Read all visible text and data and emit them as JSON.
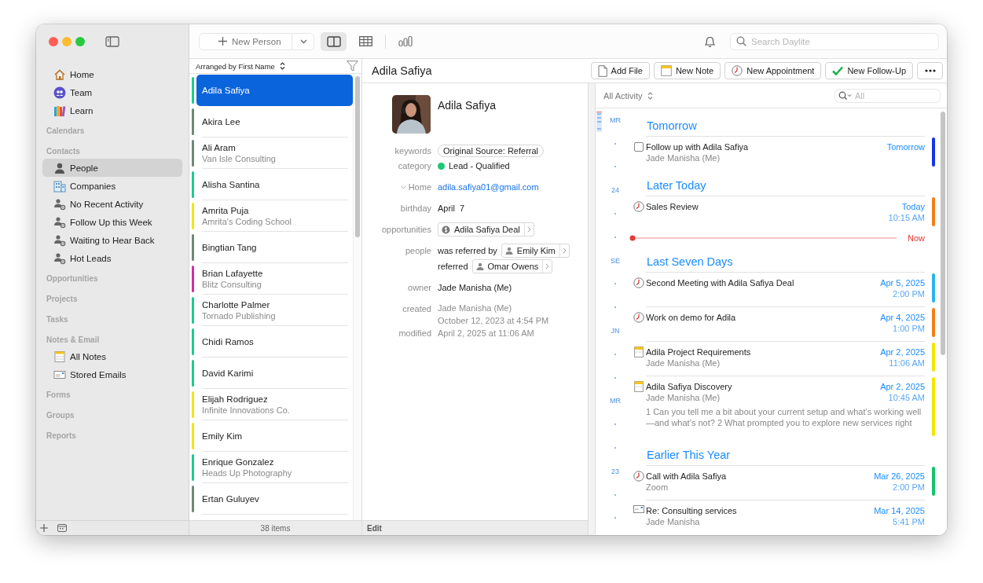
{
  "sidebar": {
    "groups": [
      {
        "items": [
          {
            "label": "Home",
            "kind": "home",
            "selected": false
          },
          {
            "label": "Team",
            "kind": "team",
            "selected": false
          },
          {
            "label": "Learn",
            "kind": "learn",
            "selected": false
          }
        ]
      },
      {
        "heading": "Calendars"
      },
      {
        "heading": "Contacts",
        "items": [
          {
            "label": "People",
            "kind": "person",
            "selected": true
          },
          {
            "label": "Companies",
            "kind": "company",
            "selected": false
          },
          {
            "label": "No Recent Activity",
            "kind": "smart",
            "selected": false
          },
          {
            "label": "Follow Up this Week",
            "kind": "smart",
            "selected": false
          },
          {
            "label": "Waiting to Hear Back",
            "kind": "smart",
            "selected": false
          },
          {
            "label": "Hot Leads",
            "kind": "smart",
            "selected": false
          }
        ]
      },
      {
        "heading": "Opportunities"
      },
      {
        "heading": "Projects"
      },
      {
        "heading": "Tasks"
      },
      {
        "heading": "Notes & Email",
        "items": [
          {
            "label": "All Notes",
            "kind": "notes",
            "selected": false
          },
          {
            "label": "Stored Emails",
            "kind": "emails",
            "selected": false
          }
        ]
      },
      {
        "heading": "Forms"
      },
      {
        "heading": "Groups"
      },
      {
        "heading": "Reports"
      }
    ]
  },
  "toolbar": {
    "new_button": "New Person",
    "views": [
      {
        "kind": "split",
        "selected": true
      },
      {
        "kind": "table",
        "selected": false
      },
      {
        "kind": "chart",
        "selected": false
      }
    ],
    "search_placeholder": "Search Daylite"
  },
  "people_list": {
    "sort_label": "Arranged by First Name",
    "count": "38 items",
    "items": [
      {
        "name": "Adila Safiya",
        "color": "#1fca8a",
        "selected": true
      },
      {
        "name": "Akira Lee",
        "color": "#6f8877",
        "selected": false
      },
      {
        "name": "Ali Aram",
        "company": "Van Isle Consulting",
        "color": "#6f8877",
        "selected": false
      },
      {
        "name": "Alisha Santina",
        "color": "#1fca8a",
        "selected": false
      },
      {
        "name": "Amrita Puja",
        "company": "Amrita's Coding School",
        "color": "#f2e41c",
        "selected": false
      },
      {
        "name": "Bingtian Tang",
        "color": "#6f8877",
        "selected": false
      },
      {
        "name": "Brian Lafayette",
        "company": "Blitz Consulting",
        "color": "#cf2ea6",
        "selected": false
      },
      {
        "name": "Charlotte Palmer",
        "company": "Tornado Publishing",
        "color": "#1fca8a",
        "selected": false
      },
      {
        "name": "Chidi Ramos",
        "color": "#1fca8a",
        "selected": false
      },
      {
        "name": "David Karimi",
        "color": "#1fca8a",
        "selected": false
      },
      {
        "name": "Elijah Rodriguez",
        "company": "Infinite Innovations Co.",
        "color": "#f2e41c",
        "selected": false
      },
      {
        "name": "Emily Kim",
        "color": "#f2e41c",
        "selected": false
      },
      {
        "name": "Enrique Gonzalez",
        "company": "Heads Up Photography",
        "color": "#1fca8a",
        "selected": false
      },
      {
        "name": "Ertan Guluyev",
        "color": "#6f8877",
        "selected": false
      }
    ]
  },
  "detail": {
    "title": "Adila Safiya",
    "footer": "Edit",
    "actions": [
      {
        "label": "Add File",
        "kind": "file"
      },
      {
        "label": "New Note",
        "kind": "note"
      },
      {
        "label": "New Appointment",
        "kind": "appointment"
      },
      {
        "label": "New Follow-Up",
        "kind": "followup"
      },
      {
        "kind": "more"
      }
    ],
    "name": "Adila Safiya",
    "fields": [
      {
        "label": "keywords",
        "kind": "tag",
        "value": "Original Source: Referral"
      },
      {
        "label": "category",
        "kind": "category",
        "value": "Lead - Qualified",
        "color": "#1fc777"
      },
      {
        "label": "Home",
        "kind": "email",
        "value": "adila.safiya01@gmail.com"
      },
      {
        "label": "birthday",
        "kind": "text",
        "value": "April  7"
      },
      {
        "label": "opportunities",
        "kind": "opportunity",
        "value": "Adila Safiya Deal"
      },
      {
        "label": "people",
        "kind": "relations",
        "relations": [
          {
            "relation": "was referred by",
            "person": "Emily Kim"
          },
          {
            "relation": "referred",
            "person": "Omar Owens"
          }
        ]
      },
      {
        "label": "owner",
        "kind": "text",
        "value": "Jade Manisha (Me)"
      },
      {
        "label": "created",
        "kind": "muted",
        "lines": [
          "Jade Manisha (Me)",
          "October 12, 2023 at 4:54 PM"
        ]
      },
      {
        "label": "modified",
        "kind": "muted",
        "lines": [
          "April 2, 2025 at 11:06 AM"
        ]
      }
    ]
  },
  "activity": {
    "filter": "All Activity",
    "search_placeholder": "All",
    "timeline": [
      "MR",
      "24",
      "SE",
      "JN",
      "MR",
      "23"
    ],
    "sections": [
      {
        "heading": "Tomorrow",
        "items": [
          {
            "kind": "task",
            "checked": false,
            "title": "Follow up with Adila Safiya",
            "subtitle": "Jade Manisha (Me)",
            "date": "Tomorrow",
            "color": "#1633e6"
          }
        ]
      },
      {
        "heading": "Later Today",
        "now_label": "Now",
        "items": [
          {
            "kind": "appointment",
            "title": "Sales Review",
            "date": "Today",
            "time": "10:15 AM",
            "color": "#f57f17"
          }
        ]
      },
      {
        "heading": "Last Seven Days",
        "items": [
          {
            "kind": "appointment",
            "title": "Second Meeting with Adila Safiya Deal",
            "date": "Apr 5, 2025",
            "time": "2:00 PM",
            "color": "#2bb3ee"
          },
          {
            "kind": "appointment",
            "title": "Work on demo for Adila",
            "date": "Apr 4, 2025",
            "time": "1:00 PM",
            "color": "#f57f17"
          },
          {
            "kind": "note",
            "title": "Adila Project Requirements",
            "subtitle": "Jade Manisha (Me)",
            "date": "Apr 2, 2025",
            "time": "11:06 AM",
            "color": "#f2e600"
          },
          {
            "kind": "note",
            "title": "Adila Safiya Discovery",
            "subtitle": "Jade Manisha (Me)",
            "date": "Apr 2, 2025",
            "time": "10:45 AM",
            "color": "#f2e600",
            "body": "1 Can you tell me a bit about your current setup and what’s working well—and what’s not? 2 What prompted you to explore new services right"
          }
        ]
      },
      {
        "heading": "Earlier This Year",
        "items": [
          {
            "kind": "appointment",
            "title": "Call with Adila Safiya",
            "subtitle": "Zoom",
            "date": "Mar 26, 2025",
            "time": "2:00 PM",
            "color": "#14c36a"
          },
          {
            "kind": "email",
            "title": "Re: Consulting services",
            "subtitle": "Jade Manisha",
            "date": "Mar 14, 2025",
            "time": "5:41 PM"
          }
        ]
      }
    ]
  }
}
